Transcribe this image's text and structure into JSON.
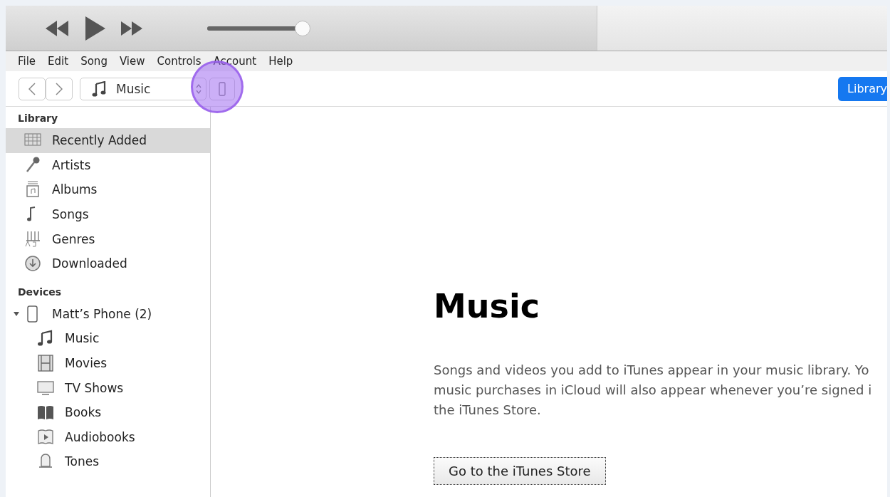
{
  "player": {
    "buttons": [
      {
        "kind": "rewind"
      },
      {
        "kind": "play"
      },
      {
        "kind": "forward"
      }
    ],
    "volume": {
      "level": 1
    }
  },
  "menu": [
    "File",
    "Edit",
    "Song",
    "View",
    "Controls",
    "Account",
    "Help"
  ],
  "toolbar": {
    "media_picker": {
      "value": "Music"
    },
    "device_button": {
      "highlighted": true
    },
    "library_button": "Library"
  },
  "sidebar": {
    "sections": [
      {
        "title": "Library",
        "items": [
          {
            "label": "Recently Added",
            "kind": "grid",
            "selected": true
          },
          {
            "label": "Artists",
            "kind": "mic",
            "selected": false
          },
          {
            "label": "Albums",
            "kind": "album",
            "selected": false
          },
          {
            "label": "Songs",
            "kind": "note",
            "selected": false
          },
          {
            "label": "Genres",
            "kind": "genres",
            "selected": false
          },
          {
            "label": "Downloaded",
            "kind": "download",
            "selected": false
          }
        ]
      },
      {
        "title": "Devices",
        "items": [
          {
            "label": "Matt’s Phone (2)",
            "kind": "phone",
            "selected": false,
            "expanded": true,
            "children": [
              {
                "label": "Music",
                "kind": "notes",
                "selected": false
              },
              {
                "label": "Movies",
                "kind": "film",
                "selected": false
              },
              {
                "label": "TV Shows",
                "kind": "tv",
                "selected": false
              },
              {
                "label": "Books",
                "kind": "book",
                "selected": false
              },
              {
                "label": "Audiobooks",
                "kind": "audiobook",
                "selected": false
              },
              {
                "label": "Tones",
                "kind": "bell",
                "selected": false
              }
            ]
          }
        ]
      }
    ]
  },
  "main": {
    "heading": "Music",
    "paragraph_lines": [
      "Songs and videos you add to iTunes appear in your music library. Yo",
      "music purchases in iCloud will also appear whenever you’re signed i",
      "the iTunes Store."
    ],
    "button": "Go to the iTunes Store"
  }
}
